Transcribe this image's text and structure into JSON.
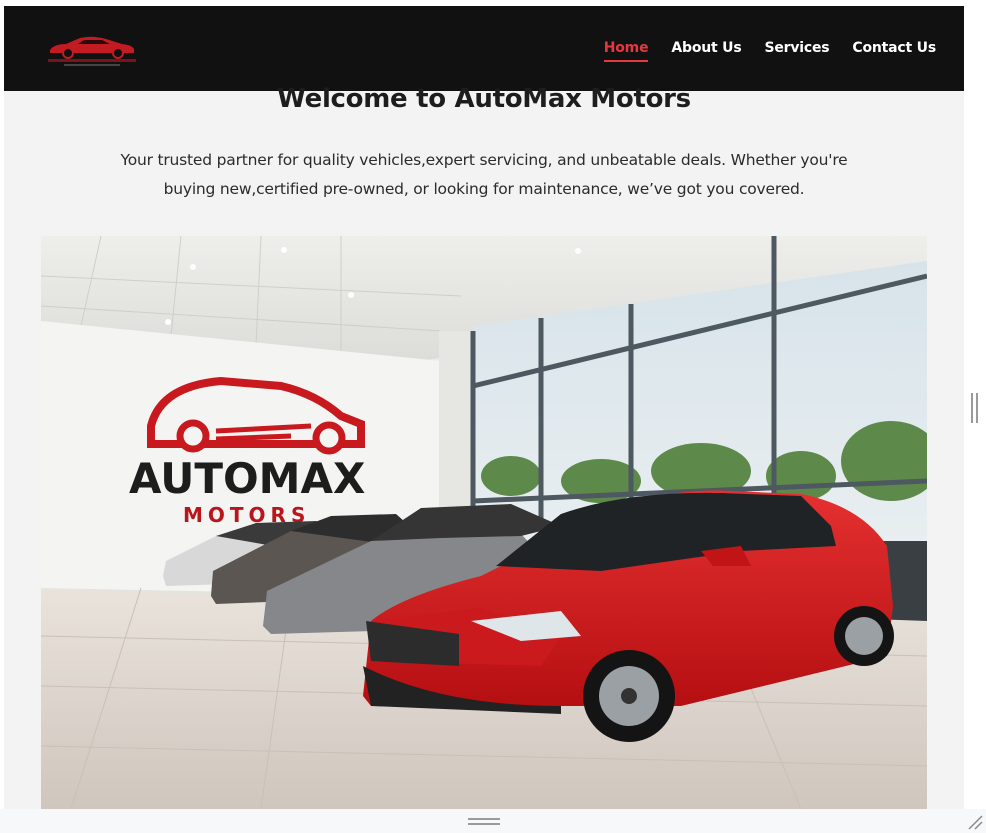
{
  "nav": {
    "brand_logo": "automax-motors-logo",
    "links": [
      "Home",
      "About Us",
      "Services",
      "Contact Us"
    ],
    "active": "Home"
  },
  "hero": {
    "title": "Welcome to AutoMax Motors",
    "description": "Your trusted partner for quality vehicles,expert servicing, and unbeatable deals. Whether you're buying new,certified pre-owned, or looking for maintenance, we’ve got you covered."
  },
  "showroom": {
    "wall_logo_main": "AUTOMAX",
    "wall_logo_sub": "MOTORS"
  },
  "colors": {
    "navbar_bg": "#111111",
    "accent_red": "#e8363f",
    "page_bg": "#f3f3f3"
  }
}
